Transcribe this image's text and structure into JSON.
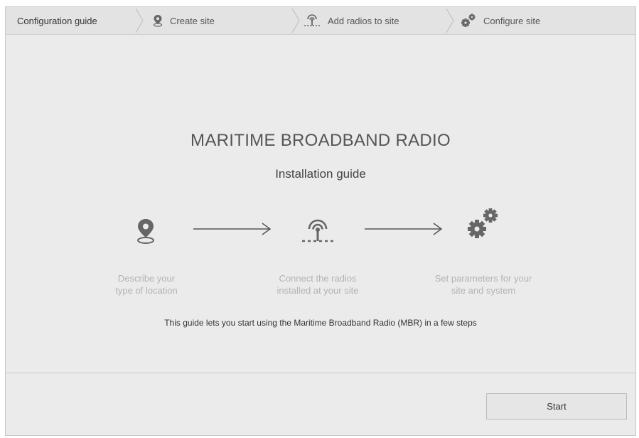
{
  "breadcrumb": {
    "items": [
      {
        "label": "Configuration guide",
        "icon": ""
      },
      {
        "label": "Create site",
        "icon": "location-pin-icon"
      },
      {
        "label": "Add radios to site",
        "icon": "radio-antenna-icon"
      },
      {
        "label": "Configure site",
        "icon": "gears-icon"
      }
    ]
  },
  "main": {
    "title": "MARITIME BROADBAND RADIO",
    "subtitle": "Installation guide",
    "steps": [
      {
        "icon": "location-pin-icon",
        "line1": "Describe your",
        "line2": "type of location"
      },
      {
        "icon": "radio-antenna-icon",
        "line1": "Connect the radios",
        "line2": "installed at your site"
      },
      {
        "icon": "gears-icon",
        "line1": "Set parameters for your",
        "line2": "site and system"
      }
    ],
    "tagline": "This guide lets you start using the Maritime Broadband Radio (MBR) in a few steps"
  },
  "footer": {
    "start_label": "Start"
  },
  "colors": {
    "background": "#ebebeb",
    "icon": "#666666",
    "step_text": "#b3b3b3"
  }
}
